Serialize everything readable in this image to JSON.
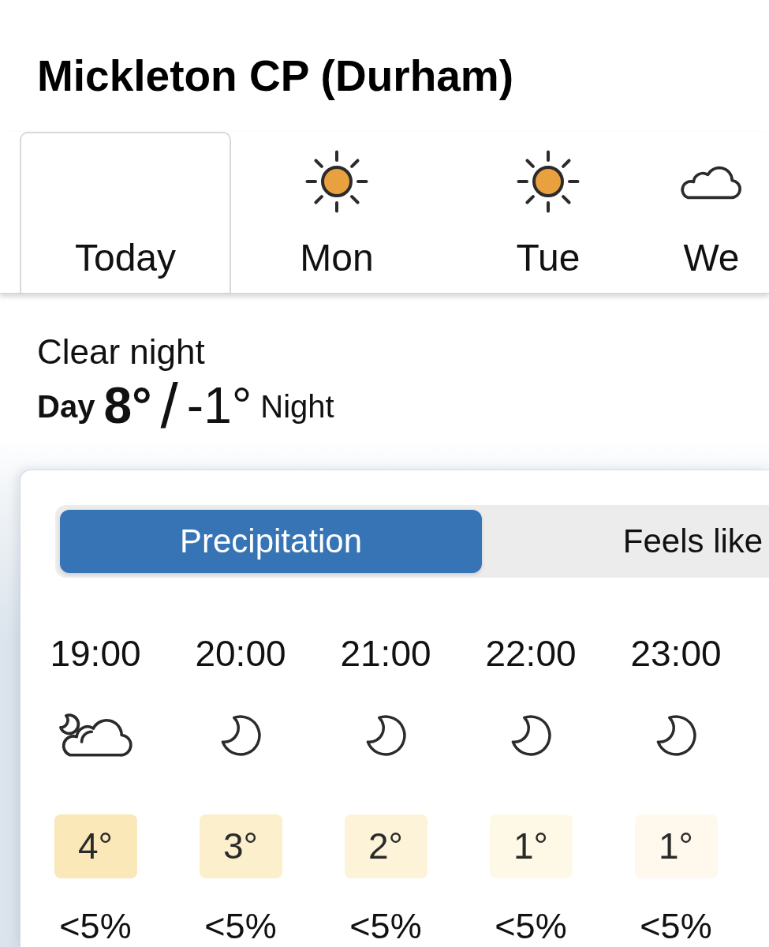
{
  "location": "Mickleton CP (Durham)",
  "days": [
    {
      "label": "Today",
      "kind": "none",
      "selected": true
    },
    {
      "label": "Mon",
      "kind": "sunny",
      "selected": false
    },
    {
      "label": "Tue",
      "kind": "sunny",
      "selected": false
    },
    {
      "label": "We",
      "kind": "cloudy",
      "selected": false
    }
  ],
  "summary": {
    "condition": "Clear night",
    "day_label": "Day",
    "day_temp": "8°",
    "separator": "/",
    "night_temp": "-1°",
    "night_label": "Night"
  },
  "view_toggle": [
    {
      "label": "Precipitation",
      "selected": true
    },
    {
      "label": "Feels like",
      "selected": false
    }
  ],
  "hours": [
    {
      "time": "19:00",
      "kind": "cloudy",
      "temp": "4°",
      "color": "#fbe8b8",
      "precip": "<5%"
    },
    {
      "time": "20:00",
      "kind": "clear",
      "temp": "3°",
      "color": "#fcefcc",
      "precip": "<5%"
    },
    {
      "time": "21:00",
      "kind": "clear",
      "temp": "2°",
      "color": "#fdf3d9",
      "precip": "<5%"
    },
    {
      "time": "22:00",
      "kind": "clear",
      "temp": "1°",
      "color": "#fef8e6",
      "precip": "<5%"
    },
    {
      "time": "23:00",
      "kind": "clear",
      "temp": "1°",
      "color": "#fef9ec",
      "precip": "<5%"
    }
  ]
}
